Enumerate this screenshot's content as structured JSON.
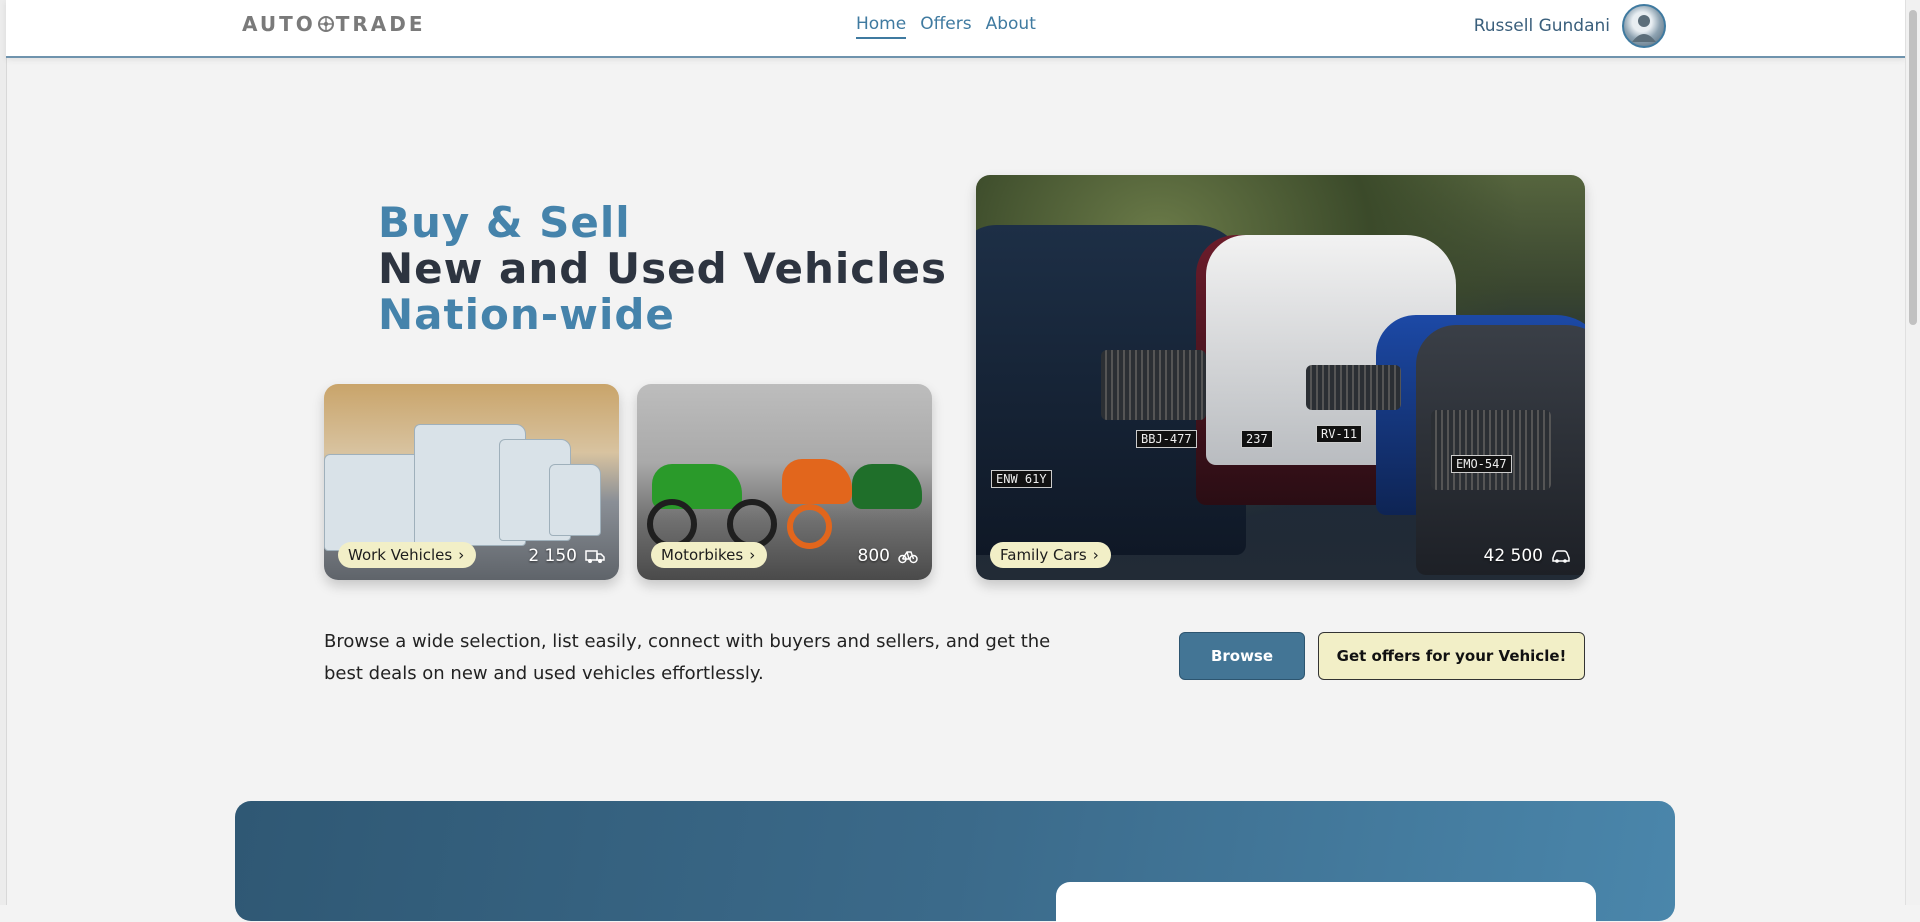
{
  "nav": {
    "logo_left": "AUTO",
    "logo_right": "TRADE",
    "links": [
      {
        "label": "Home",
        "active": true
      },
      {
        "label": "Offers",
        "active": false
      },
      {
        "label": "About",
        "active": false
      }
    ],
    "user_name": "Russell Gundani"
  },
  "hero": {
    "line1": "Buy & Sell",
    "line2": "New and Used Vehicles",
    "line3": "Nation-wide"
  },
  "categories": {
    "work": {
      "label": "Work Vehicles",
      "count": "2 150",
      "icon": "truck-icon"
    },
    "moto": {
      "label": "Motorbikes",
      "count": "800",
      "icon": "bike-icon"
    },
    "family": {
      "label": "Family Cars",
      "count": "42 500",
      "icon": "car-icon"
    }
  },
  "plates": [
    "ENW 61Y",
    "BBJ-477",
    "237",
    "RV-11",
    "EMO-547"
  ],
  "tagline": "Browse a wide selection, list easily, connect with buyers and sellers, and get the best deals on new and used vehicles effortlessly.",
  "buttons": {
    "browse": "Browse",
    "offers": "Get offers for your Vehicle!"
  },
  "colors": {
    "accent": "#4583ab",
    "button_primary": "#437595",
    "pill_bg": "#f2efc7",
    "heading_dark": "#2d3440"
  }
}
